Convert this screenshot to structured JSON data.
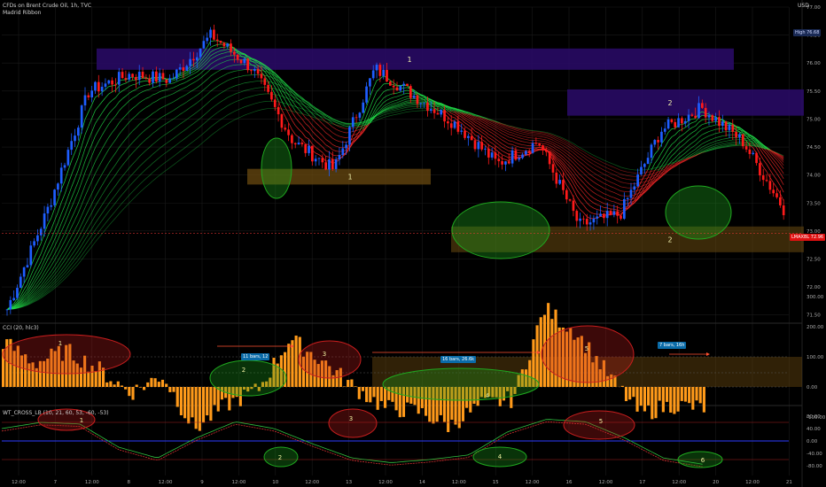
{
  "header": {
    "symbol_line": "CFDs on Brent Crude Oil, 1h, TVC",
    "ribbon_label": "Madrid Ribbon",
    "currency": "USD",
    "cci_label": "CCI (20, hlc3)",
    "wt_label": "WT_CROSS_LB (10, 21, 60, 53, -60, -53)"
  },
  "price_axis": {
    "ticks": [
      "77.00",
      "76.50",
      "76.00",
      "75.50",
      "75.00",
      "74.50",
      "74.00",
      "73.50",
      "73.00",
      "72.50",
      "72.00",
      "71.50"
    ],
    "high_label": "High",
    "high_value": "76.68",
    "current_label": "LMAXBL",
    "current_value": "72.96"
  },
  "cci_axis": {
    "ticks": [
      "300.00",
      "200.00",
      "100.00",
      "0.00",
      "-100.00"
    ]
  },
  "wt_axis": {
    "ticks": [
      "80.00",
      "40.00",
      "0.00",
      "-40.00",
      "-80.00"
    ]
  },
  "time_axis": {
    "ticks": [
      "12:00",
      "7",
      "12:00",
      "8",
      "12:00",
      "9",
      "12:00",
      "10",
      "12:00",
      "13",
      "12:00",
      "14",
      "12:00",
      "15",
      "12:00",
      "16",
      "12:00",
      "17",
      "12:00",
      "20",
      "12:00",
      "21"
    ]
  },
  "zones": {
    "resistance_1": "1",
    "resistance_2": "2",
    "support_1": "1",
    "support_2": "2"
  },
  "cci_annotations": {
    "ellipses": [
      "1",
      "2",
      "3",
      "4",
      "5"
    ],
    "tags": [
      "11 bars, 12",
      "16 bars, 26.6k",
      "7 bars, 16h"
    ]
  },
  "wt_annotations": {
    "ellipses": [
      "1",
      "2",
      "3",
      "4",
      "5",
      "6"
    ]
  },
  "colors": {
    "background": "#000000",
    "bull_candle": "#1e5eff",
    "bear_candle": "#ff1a1a",
    "ribbon_green": "#22e04a",
    "ribbon_red": "#ff2a2a",
    "resistance_zone": "#2a0a6a",
    "support_zone": "#6a4a10",
    "cci_bar": "#ff9a1a",
    "ellipse_red": "#c81e1e",
    "ellipse_green": "#1fa81f"
  },
  "chart_data": {
    "type": "candlestick",
    "title": "CFDs on Brent Crude Oil, 1h, TVC",
    "ylim": [
      71.4,
      77.0
    ],
    "xlabel": "",
    "ylabel": "USD",
    "x": [
      "6 12:00",
      "7",
      "7 12:00",
      "8",
      "8 12:00",
      "9",
      "9 12:00",
      "10",
      "10 12:00",
      "13",
      "13 12:00",
      "14",
      "14 12:00",
      "15",
      "15 12:00",
      "16",
      "16 12:00",
      "17",
      "17 12:00",
      "20"
    ],
    "series": [
      {
        "values": [
          71.6,
          73.4,
          75.5,
          75.8,
          75.7,
          76.5,
          75.9,
          74.6,
          74.1,
          75.9,
          75.4,
          74.9,
          74.2,
          74.6,
          73.1,
          73.3,
          74.8,
          75.2,
          74.6,
          73.4
        ]
      }
    ],
    "zones": [
      {
        "label": "1",
        "type": "resistance",
        "y_range": [
          75.88,
          76.26
        ]
      },
      {
        "label": "2",
        "type": "resistance",
        "y_range": [
          75.06,
          75.53
        ]
      },
      {
        "label": "1",
        "type": "support",
        "y_range": [
          73.83,
          74.11
        ]
      },
      {
        "label": "2",
        "type": "support",
        "y_range": [
          72.62,
          73.08
        ]
      }
    ],
    "subcharts": [
      {
        "name": "CCI (20, hlc3)",
        "ylim": [
          -200,
          300
        ]
      },
      {
        "name": "WT_CROSS_LB (10, 21, 60, 53, -60, -53)",
        "ylim": [
          -100,
          100
        ]
      }
    ]
  }
}
